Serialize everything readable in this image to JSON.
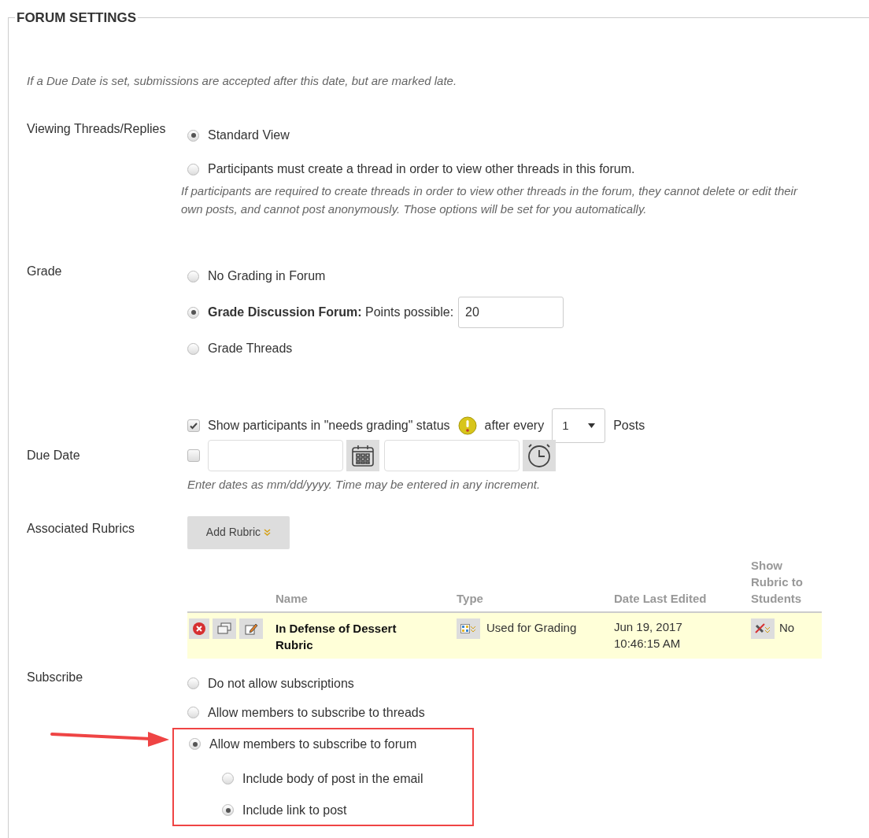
{
  "section_title": "FORUM SETTINGS",
  "due_date_note": "If a Due Date is set, submissions are accepted after this date, but are marked late.",
  "viewing": {
    "label": "Viewing Threads/Replies",
    "options": [
      {
        "label": "Standard View",
        "selected": true
      },
      {
        "label": "Participants must create a thread in order to view other threads in this forum.",
        "selected": false
      }
    ],
    "help": "If participants are required to create threads in order to view other threads in the forum, they cannot delete or edit their own posts, and cannot post anonymously. Those options will be set for you automatically."
  },
  "grade": {
    "label": "Grade",
    "options": [
      {
        "label": "No Grading in Forum",
        "selected": false
      },
      {
        "label": "**Grade Discussion Forum:** Points possible:",
        "selected": true,
        "points": "20"
      },
      {
        "label": "Grade Threads",
        "selected": false
      }
    ]
  },
  "needs_grading": {
    "checked": true,
    "label": "Show participants in \"needs grading\" status",
    "after": "after every",
    "count": "1",
    "unit": "Posts"
  },
  "due_date": {
    "label": "Due Date",
    "checked": false,
    "help": "Enter dates as mm/dd/yyyy. Time may be entered in any increment."
  },
  "rubrics": {
    "label": "Associated Rubrics",
    "add_button": "Add Rubric",
    "columns": [
      "Name",
      "Type",
      "Date Last Edited",
      "Show Rubric to Students"
    ],
    "rows": [
      {
        "name": "In Defense of Dessert Rubric",
        "type": "Used for Grading",
        "date": "Jun 19, 2017 10:46:15 AM",
        "show": "No"
      }
    ]
  },
  "subscribe": {
    "label": "Subscribe",
    "options": [
      {
        "label": "Do not allow subscriptions",
        "selected": false,
        "highlighted": false
      },
      {
        "label": "Allow members to subscribe to threads",
        "selected": false,
        "highlighted": false
      },
      {
        "label": "Allow members to subscribe to forum",
        "selected": true,
        "highlighted": true,
        "children": [
          {
            "label": "Include body of post in the email",
            "selected": false
          },
          {
            "label": "Include link to post",
            "selected": true
          }
        ]
      }
    ]
  }
}
